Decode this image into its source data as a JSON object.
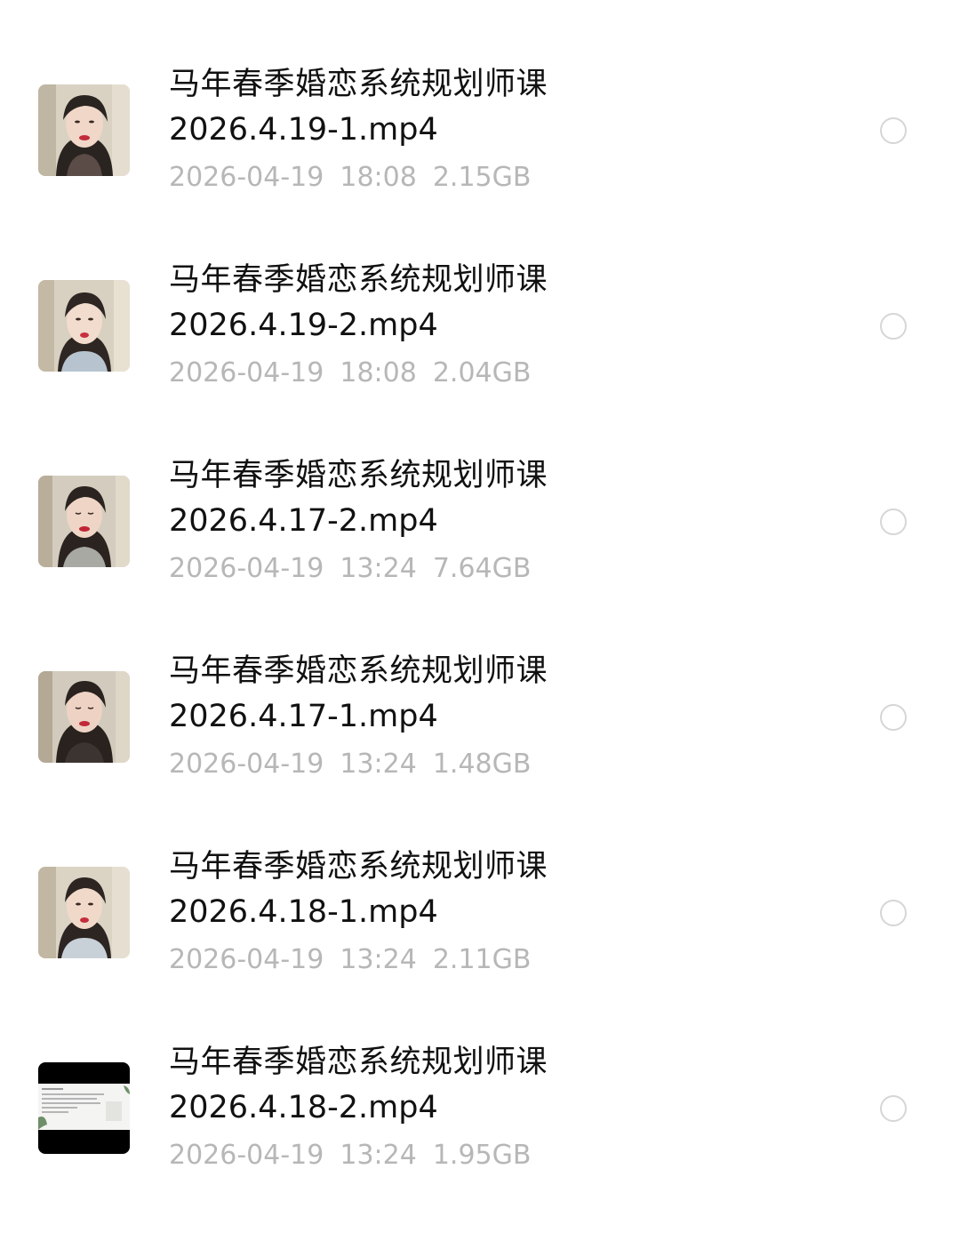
{
  "files": [
    {
      "title": "马年春季婚恋系统规划师课",
      "filename": "2026.4.19-1.mp4",
      "date": "2026-04-19",
      "time": "18:08",
      "size": "2.15GB",
      "thumbnail": "video-thumbnail-presenter"
    },
    {
      "title": "马年春季婚恋系统规划师课",
      "filename": "2026.4.19-2.mp4",
      "date": "2026-04-19",
      "time": "18:08",
      "size": "2.04GB",
      "thumbnail": "video-thumbnail-presenter"
    },
    {
      "title": "马年春季婚恋系统规划师课",
      "filename": "2026.4.17-2.mp4",
      "date": "2026-04-19",
      "time": "13:24",
      "size": "7.64GB",
      "thumbnail": "video-thumbnail-presenter"
    },
    {
      "title": "马年春季婚恋系统规划师课",
      "filename": "2026.4.17-1.mp4",
      "date": "2026-04-19",
      "time": "13:24",
      "size": "1.48GB",
      "thumbnail": "video-thumbnail-presenter"
    },
    {
      "title": "马年春季婚恋系统规划师课",
      "filename": "2026.4.18-1.mp4",
      "date": "2026-04-19",
      "time": "13:24",
      "size": "2.11GB",
      "thumbnail": "video-thumbnail-presenter"
    },
    {
      "title": "马年春季婚恋系统规划师课",
      "filename": "2026.4.18-2.mp4",
      "date": "2026-04-19",
      "time": "13:24",
      "size": "1.95GB",
      "thumbnail": "video-thumbnail-slides"
    }
  ],
  "colors": {
    "background": "#ffffff",
    "title_text": "#111111",
    "meta_text": "#b7b7b7",
    "radio_border": "#d6d6d6"
  }
}
